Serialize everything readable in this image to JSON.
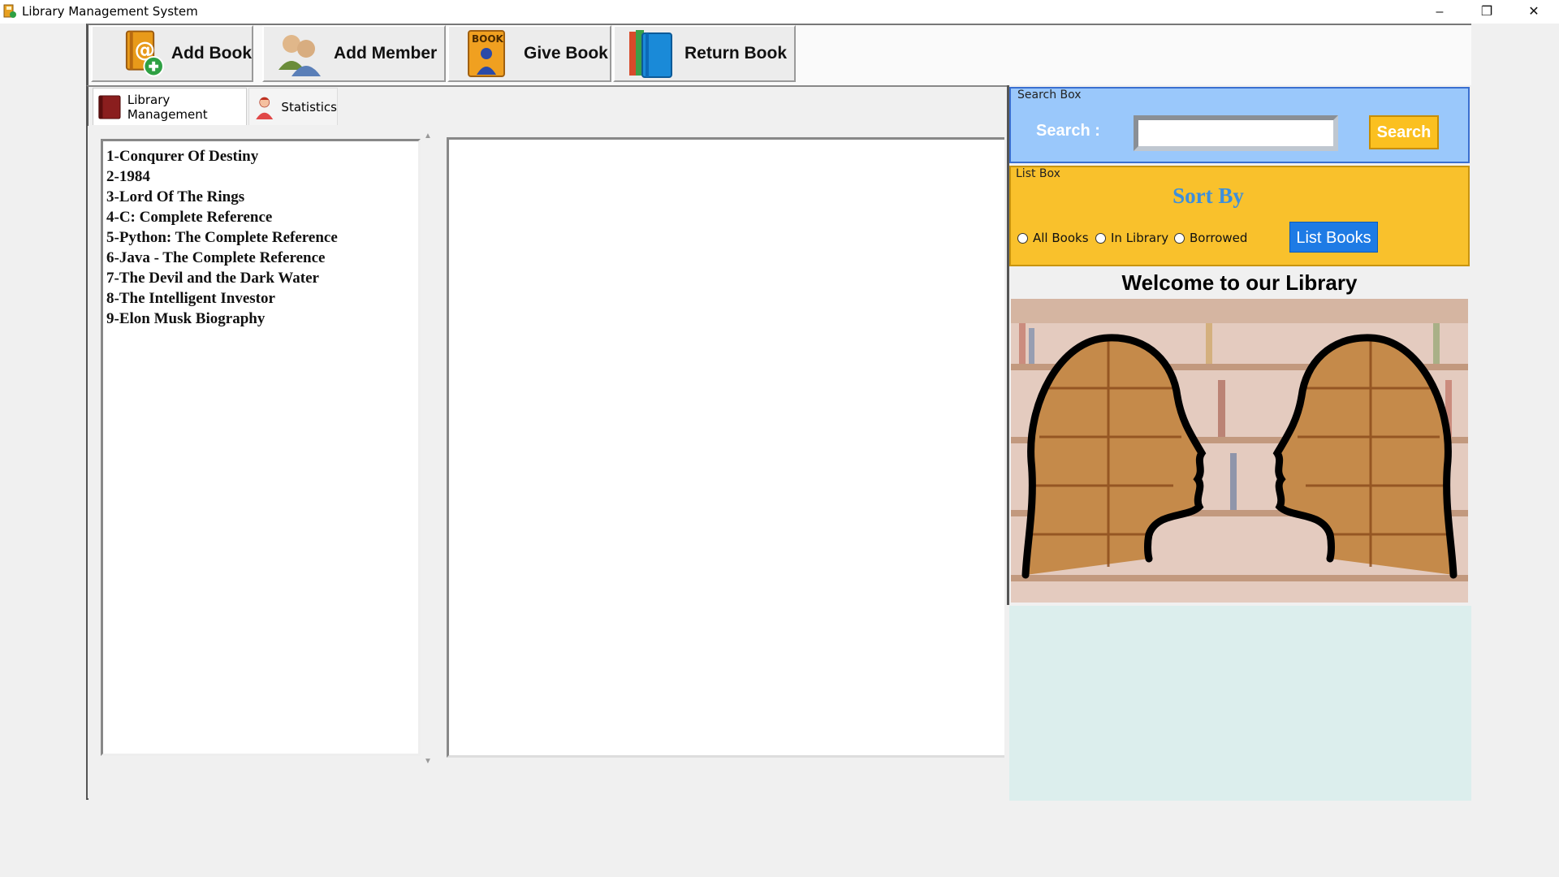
{
  "window": {
    "title": "Library Management System",
    "controls": [
      "–",
      "❐",
      "✕"
    ]
  },
  "toolbar": {
    "buttons": [
      {
        "label": "Add Book",
        "icon": "add-book-icon"
      },
      {
        "label": "Add Member",
        "icon": "add-member-icon"
      },
      {
        "label": "Give Book",
        "icon": "give-book-icon"
      },
      {
        "label": "Return Book",
        "icon": "return-book-icon"
      }
    ]
  },
  "tabs": [
    {
      "label": "Library Management",
      "icon": "library-book-icon"
    },
    {
      "label": "Statistics",
      "icon": "person-icon"
    }
  ],
  "books": [
    "1-Conqurer Of Destiny",
    "2-1984",
    "3-Lord Of The Rings",
    "4-C: Complete Reference",
    "5-Python: The Complete Reference",
    "6-Java - The Complete Reference",
    "7-The Devil and the Dark Water",
    "8-The Intelligent Investor",
    "9-Elon Musk Biography"
  ],
  "search_box": {
    "legend": "Search Box",
    "label": "Search :",
    "value": "",
    "button": "Search"
  },
  "list_box": {
    "legend": "List Box",
    "heading": "Sort By",
    "options": [
      "All Books",
      "In Library",
      "Borrowed"
    ],
    "button": "List Books"
  },
  "welcome": "Welcome to our Library",
  "colors": {
    "search_bg": "#9ac8fb",
    "list_bg": "#f9c12c",
    "sort_heading": "#3d8fdc",
    "list_button": "#1e7be5",
    "search_button": "#fbc020"
  }
}
